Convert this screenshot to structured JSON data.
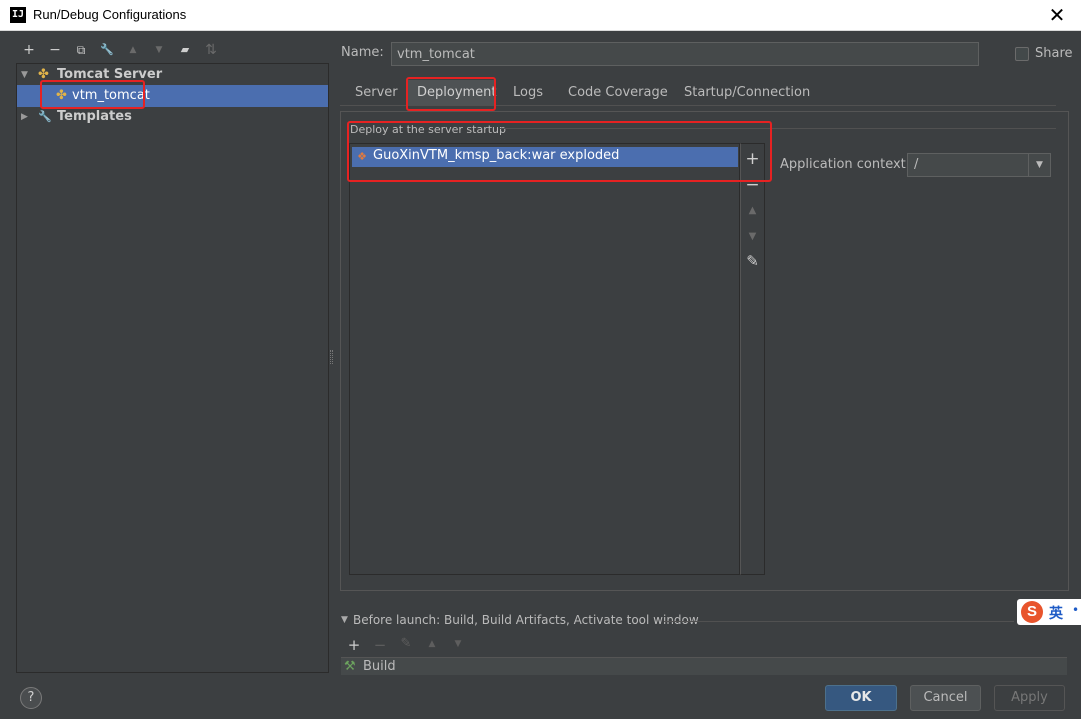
{
  "window": {
    "app_icon_text": "IJ",
    "title": "Run/Debug Configurations",
    "close_glyph": "✕"
  },
  "left_toolbar": {
    "icons": [
      {
        "name": "add-icon",
        "glyph": "+"
      },
      {
        "name": "remove-icon",
        "glyph": "−"
      },
      {
        "name": "copy-icon",
        "glyph": "⧉"
      },
      {
        "name": "wrench-icon",
        "glyph": "🔧"
      },
      {
        "name": "move-up-icon",
        "glyph": "▲"
      },
      {
        "name": "move-down-icon",
        "glyph": "▼"
      },
      {
        "name": "new-folder-icon",
        "glyph": "▰"
      },
      {
        "name": "sort-icon",
        "glyph": "⇅"
      }
    ]
  },
  "tree": {
    "group_label": "Tomcat Server",
    "selected_item": "vtm_tomcat",
    "templates_label": "Templates"
  },
  "name_field": {
    "label": "Name:",
    "value": "vtm_tomcat"
  },
  "share": {
    "label": "Share",
    "checked": false
  },
  "tabs": [
    {
      "label": "Server"
    },
    {
      "label": "Deployment",
      "active": true
    },
    {
      "label": "Logs"
    },
    {
      "label": "Code Coverage"
    },
    {
      "label": "Startup/Connection"
    }
  ],
  "deployment": {
    "section_title": "Deploy at the server startup",
    "artifacts": [
      "GuoXinVTM_kmsp_back:war exploded"
    ],
    "tools": [
      "+",
      "−",
      "▲",
      "▼",
      "✎"
    ],
    "context_label": "Application context:",
    "context_value": "/"
  },
  "before_launch": {
    "title": "Before launch: Build, Build Artifacts, Activate tool window",
    "tools": [
      "+",
      "−",
      "✎",
      "▲",
      "▼"
    ],
    "items": [
      "Build"
    ]
  },
  "ime": {
    "logo": "S",
    "text": "英",
    "dot": "•"
  },
  "buttons": {
    "help": "?",
    "ok": "OK",
    "cancel": "Cancel",
    "apply": "Apply"
  },
  "colors": {
    "background": "#3c3f41",
    "selection": "#4b6eaf",
    "ok_button": "#365880",
    "highlight_box": "#e62222"
  }
}
